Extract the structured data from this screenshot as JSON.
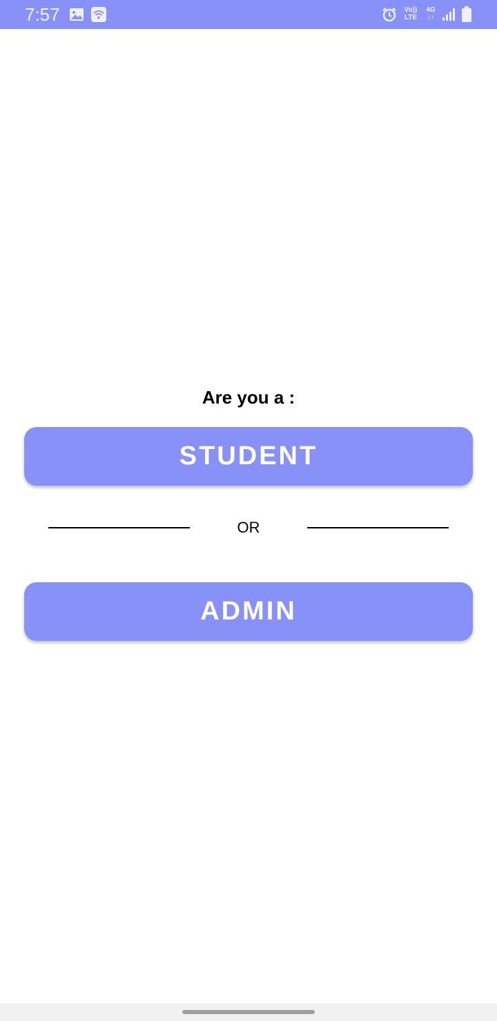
{
  "status_bar": {
    "time": "7:57",
    "left_icons": [
      "image-icon",
      "wifi-icon"
    ],
    "right_icons": [
      "alarm-icon",
      "volte-icon",
      "4g-icon",
      "signal-icon",
      "battery-icon"
    ],
    "volte_top": "Vo))",
    "volte_bottom": "LTE",
    "network_type": "4G",
    "network_arrows": "↓↑"
  },
  "main": {
    "prompt": "Are you a :",
    "student_button": "STUDENT",
    "or_text": "OR",
    "admin_button": "ADMIN"
  },
  "colors": {
    "accent": "#8891f7",
    "background": "#ffffff",
    "text": "#000000"
  }
}
